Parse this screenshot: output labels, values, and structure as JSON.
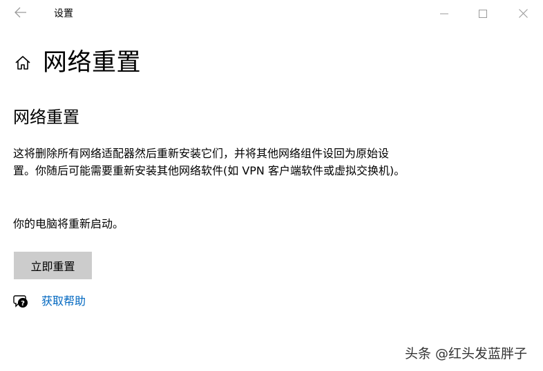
{
  "window": {
    "app_title": "设置",
    "icons": {
      "back": "back-arrow-icon",
      "minimize": "minimize-icon",
      "maximize": "maximize-icon",
      "close": "close-icon"
    }
  },
  "header": {
    "home_icon": "home-icon",
    "page_title": "网络重置"
  },
  "content": {
    "section_title": "网络重置",
    "description": "这将删除所有网络适配器然后重新安装它们，并将其他网络组件设回为原始设置。你随后可能需要重新安装其他网络软件(如 VPN 客户端软件或虚拟交换机)。",
    "restart_note": "你的电脑将重新启动。",
    "reset_button": "立即重置",
    "help_icon": "help-chat-icon",
    "help_link": "获取帮助"
  },
  "watermark": "头条 @红头发蓝胖子",
  "colors": {
    "background": "#ffffff",
    "button_bg": "#cccccc",
    "link": "#0067c0",
    "chrome_icons": "#9a9a9a"
  }
}
